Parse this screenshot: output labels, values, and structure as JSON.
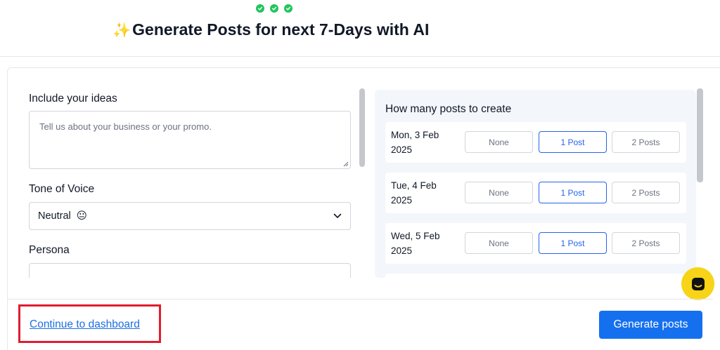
{
  "header": {
    "title": "Generate Posts for next 7-Days with AI",
    "title_emoji": "✨",
    "steps_completed": 3,
    "step_color": "#22c55e"
  },
  "form": {
    "ideas": {
      "label": "Include your ideas",
      "placeholder": "Tell us about your business or your promo."
    },
    "tone": {
      "label": "Tone of Voice",
      "selected": "Neutral",
      "selected_emoji": "😐"
    },
    "persona": {
      "label": "Persona"
    }
  },
  "posts": {
    "title": "How many posts to create",
    "options": [
      "None",
      "1 Post",
      "2 Posts"
    ],
    "days": [
      {
        "day": "Mon, 3 Feb",
        "year": "2025",
        "selected": "1 Post"
      },
      {
        "day": "Tue, 4 Feb",
        "year": "2025",
        "selected": "1 Post"
      },
      {
        "day": "Wed, 5 Feb",
        "year": "2025",
        "selected": "1 Post"
      }
    ]
  },
  "footer": {
    "continue_link": "Continue to dashboard",
    "generate_button": "Generate posts"
  },
  "colors": {
    "primary": "#1570ef",
    "link": "#1d6fe0",
    "highlight": "#e11d2e",
    "chat_bubble": "#f7d417"
  },
  "icons": {
    "step": "check-icon",
    "select": "chevron-down-icon",
    "chat": "chat-icon"
  }
}
